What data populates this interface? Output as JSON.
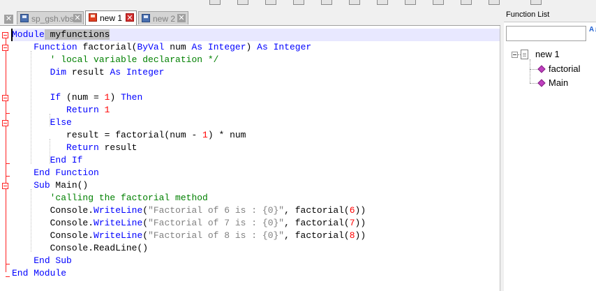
{
  "tabs": [
    {
      "label": "sp_gsh.vbs",
      "active": false
    },
    {
      "label": "new 1",
      "active": true
    },
    {
      "label": "new 2",
      "active": false
    }
  ],
  "close_glyph": "✕",
  "editor": {
    "lines": [
      [
        [
          "kw",
          "Module"
        ],
        [
          "hl",
          " myfunctions"
        ]
      ],
      [
        [
          "t",
          "    "
        ],
        [
          "kw",
          "Function"
        ],
        [
          "t",
          " factorial("
        ],
        [
          "kw",
          "ByVal"
        ],
        [
          "t",
          " num "
        ],
        [
          "kw",
          "As"
        ],
        [
          "t",
          " "
        ],
        [
          "kw",
          "Integer"
        ],
        [
          "t",
          ") "
        ],
        [
          "kw",
          "As"
        ],
        [
          "t",
          " "
        ],
        [
          "kw",
          "Integer"
        ]
      ],
      [
        [
          "t",
          "       "
        ],
        [
          "cm",
          "' local variable declaration */"
        ]
      ],
      [
        [
          "t",
          "       "
        ],
        [
          "kw",
          "Dim"
        ],
        [
          "t",
          " result "
        ],
        [
          "kw",
          "As"
        ],
        [
          "t",
          " "
        ],
        [
          "kw",
          "Integer"
        ]
      ],
      [
        [
          "t",
          ""
        ]
      ],
      [
        [
          "t",
          "       "
        ],
        [
          "kw",
          "If"
        ],
        [
          "t",
          " (num = "
        ],
        [
          "nm",
          "1"
        ],
        [
          "t",
          ") "
        ],
        [
          "kw",
          "Then"
        ]
      ],
      [
        [
          "t",
          "          "
        ],
        [
          "kw",
          "Return"
        ],
        [
          "t",
          " "
        ],
        [
          "nm",
          "1"
        ]
      ],
      [
        [
          "t",
          "       "
        ],
        [
          "kw",
          "Else"
        ]
      ],
      [
        [
          "t",
          "          result = factorial(num - "
        ],
        [
          "nm",
          "1"
        ],
        [
          "t",
          ") * num"
        ]
      ],
      [
        [
          "t",
          "          "
        ],
        [
          "kw",
          "Return"
        ],
        [
          "t",
          " result"
        ]
      ],
      [
        [
          "t",
          "       "
        ],
        [
          "kw",
          "End If"
        ]
      ],
      [
        [
          "t",
          "    "
        ],
        [
          "kw",
          "End Function"
        ]
      ],
      [
        [
          "t",
          "    "
        ],
        [
          "kw",
          "Sub"
        ],
        [
          "t",
          " Main()"
        ]
      ],
      [
        [
          "t",
          "       "
        ],
        [
          "cm",
          "'calling the factorial method"
        ]
      ],
      [
        [
          "t",
          "       Console."
        ],
        [
          "kw",
          "WriteLine"
        ],
        [
          "t",
          "("
        ],
        [
          "st",
          "\"Factorial of 6 is : {0}\""
        ],
        [
          "t",
          ", factorial("
        ],
        [
          "nm",
          "6"
        ],
        [
          "t",
          "))"
        ]
      ],
      [
        [
          "t",
          "       Console."
        ],
        [
          "kw",
          "WriteLine"
        ],
        [
          "t",
          "("
        ],
        [
          "st",
          "\"Factorial of 7 is : {0}\""
        ],
        [
          "t",
          ", factorial("
        ],
        [
          "nm",
          "7"
        ],
        [
          "t",
          "))"
        ]
      ],
      [
        [
          "t",
          "       Console."
        ],
        [
          "kw",
          "WriteLine"
        ],
        [
          "t",
          "("
        ],
        [
          "st",
          "\"Factorial of 8 is : {0}\""
        ],
        [
          "t",
          ", factorial("
        ],
        [
          "nm",
          "8"
        ],
        [
          "t",
          "))"
        ]
      ],
      [
        [
          "t",
          "       Console.ReadLine()"
        ]
      ],
      [
        [
          "t",
          "    "
        ],
        [
          "kw",
          "End Sub"
        ]
      ],
      [
        [
          "kw",
          "End Module"
        ]
      ]
    ]
  },
  "function_list": {
    "title": "Function List",
    "search_value": "",
    "sort_icon": "sort-az-icon",
    "sort_glyph": "A↓Z",
    "root": "new 1",
    "items": [
      "factorial",
      "Main"
    ]
  },
  "colors": {
    "keyword": "#0000ff",
    "comment": "#008000",
    "string": "#808080",
    "number": "#ff0000",
    "current_line": "#e8e8ff",
    "fold_marker": "#ff2020"
  }
}
